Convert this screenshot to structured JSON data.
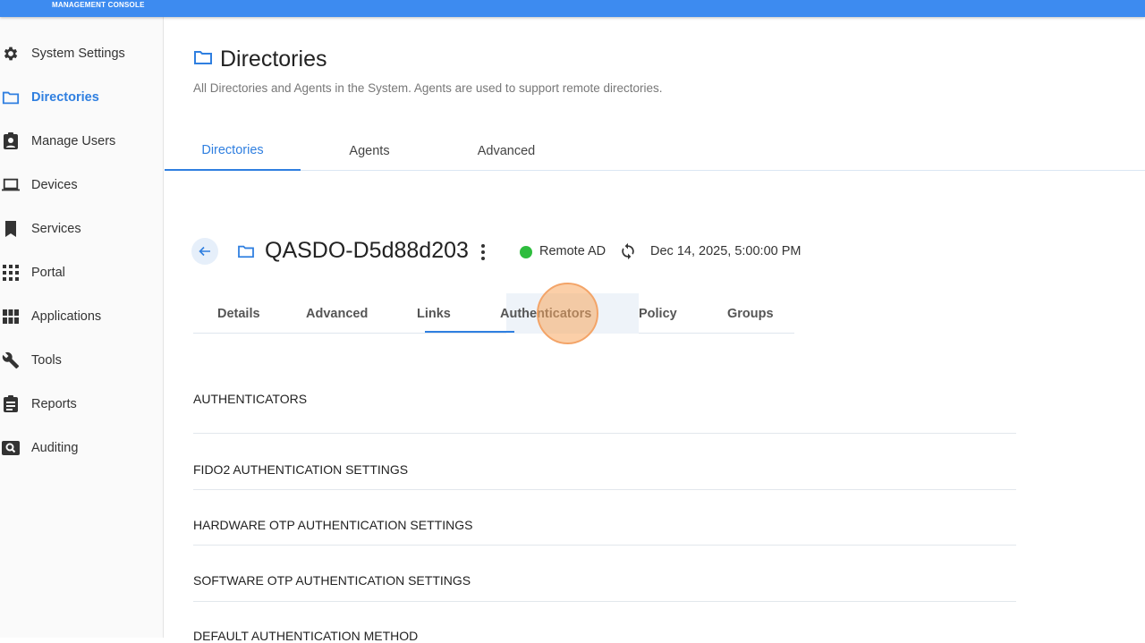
{
  "header": {
    "console_label": "MANAGEMENT CONSOLE"
  },
  "sidebar": {
    "items": [
      {
        "label": "System Settings",
        "icon": "gear-icon"
      },
      {
        "label": "Directories",
        "icon": "folder-icon",
        "active": true
      },
      {
        "label": "Manage Users",
        "icon": "user-badge-icon"
      },
      {
        "label": "Devices",
        "icon": "laptop-icon"
      },
      {
        "label": "Services",
        "icon": "bookmark-icon"
      },
      {
        "label": "Portal",
        "icon": "grid-dots-icon"
      },
      {
        "label": "Applications",
        "icon": "apps-grid-icon"
      },
      {
        "label": "Tools",
        "icon": "wrench-icon"
      },
      {
        "label": "Reports",
        "icon": "clipboard-icon"
      },
      {
        "label": "Auditing",
        "icon": "search-doc-icon"
      }
    ]
  },
  "page": {
    "title": "Directories",
    "subtitle": "All Directories and Agents in the System. Agents are used to support remote directories."
  },
  "main_tabs": [
    {
      "label": "Directories",
      "active": true
    },
    {
      "label": "Agents"
    },
    {
      "label": "Advanced"
    }
  ],
  "directory": {
    "name": "QASDO-D5d88d203",
    "status": "Remote AD",
    "timestamp": "Dec 14, 2025, 5:00:00 PM"
  },
  "sub_tabs": [
    {
      "label": "Details"
    },
    {
      "label": "Advanced"
    },
    {
      "label": "Links"
    },
    {
      "label": "Authenticators",
      "active": true
    },
    {
      "label": "Policy"
    },
    {
      "label": "Groups"
    }
  ],
  "sections": {
    "authenticators": "AUTHENTICATORS",
    "fido2": "FIDO2 AUTHENTICATION SETTINGS",
    "hardware_otp": "HARDWARE OTP AUTHENTICATION SETTINGS",
    "software_otp": "SOFTWARE OTP AUTHENTICATION SETTINGS",
    "default_method": "DEFAULT AUTHENTICATION METHOD"
  },
  "colors": {
    "accent": "#2f7fe0",
    "topbar": "#3d8bf0",
    "status_ok": "#2ebd3e"
  }
}
